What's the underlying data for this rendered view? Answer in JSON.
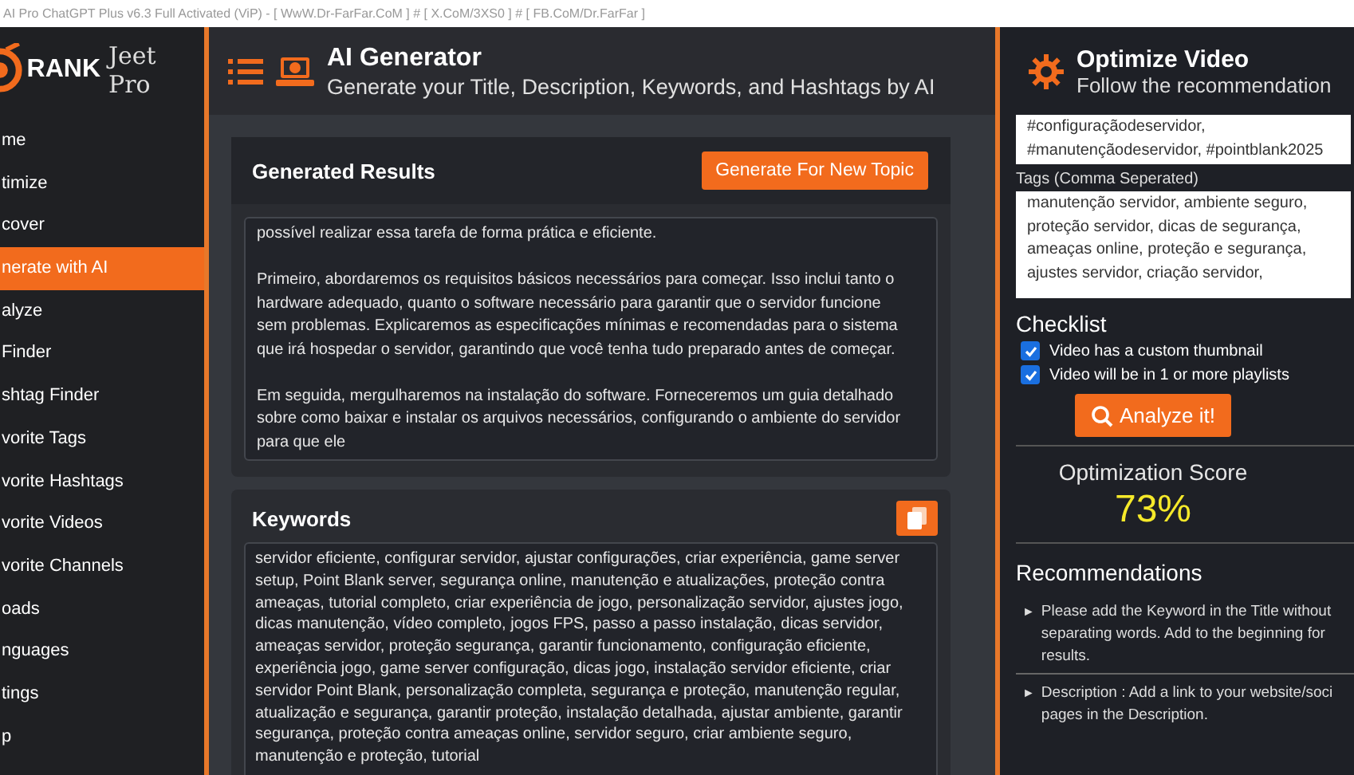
{
  "window": {
    "title": "AI Pro ChatGPT Plus v6.3 Full Activated (ViP) - [ WwW.Dr-FarFar.CoM ] # [ X.CoM/3XS0 ] # [ FB.CoM/Dr.FarFar ]"
  },
  "logo": {
    "brand": "RANK",
    "name": "Jeet Pro"
  },
  "sidebar": {
    "items": [
      {
        "label": "me",
        "selected": false
      },
      {
        "label": "timize",
        "selected": false
      },
      {
        "label": "cover",
        "selected": false
      },
      {
        "label": "nerate with AI",
        "selected": true
      },
      {
        "label": "alyze",
        "selected": false
      },
      {
        "label": "Finder",
        "selected": false
      },
      {
        "label": "shtag Finder",
        "selected": false
      },
      {
        "label": "vorite Tags",
        "selected": false
      },
      {
        "label": "vorite Hashtags",
        "selected": false
      },
      {
        "label": "vorite Videos",
        "selected": false
      },
      {
        "label": "vorite Channels",
        "selected": false
      },
      {
        "label": "oads",
        "selected": false
      },
      {
        "label": "nguages",
        "selected": false
      },
      {
        "label": "tings",
        "selected": false
      },
      {
        "label": "p",
        "selected": false
      }
    ]
  },
  "header": {
    "title": "AI Generator",
    "subtitle": "Generate your Title, Description, Keywords, and Hashtags by AI"
  },
  "results": {
    "title": "Generated Results",
    "button": "Generate For New Topic",
    "paragraphs": [
      "possível realizar essa tarefa de forma prática e eficiente.",
      "Primeiro, abordaremos os requisitos básicos necessários para começar. Isso inclui tanto o hardware adequado, quanto o software necessário para garantir que o servidor funcione sem problemas. Explicaremos as especificações mínimas e recomendadas para o sistema que irá hospedar o servidor, garantindo que você tenha tudo preparado antes de começar.",
      "Em seguida, mergulharemos na instalação do software. Forneceremos um guia detalhado sobre como baixar e instalar os arquivos necessários, configurando o ambiente do servidor para que ele"
    ]
  },
  "keywords": {
    "title": "Keywords",
    "text": "servidor eficiente, configurar servidor, ajustar configurações, criar experiência, game server setup, Point Blank server, segurança online, manutenção e atualizações, proteção contra ameaças, tutorial completo, criar experiência de jogo, personalização servidor, ajustes jogo, dicas manutenção, vídeo completo, jogos FPS, passo a passo instalação, dicas servidor, ameaças servidor, proteção segurança, garantir funcionamento, configuração eficiente, experiência jogo, game server configuração, dicas jogo, instalação servidor eficiente, criar servidor Point Blank, personalização completa, segurança e proteção, manutenção regular, atualização e segurança, garantir proteção, instalação detalhada, ajustar ambiente, garantir segurança, proteção contra ameaças online, servidor seguro, criar ambiente seguro, manutenção e proteção, tutorial"
  },
  "optimize": {
    "title": "Optimize Video",
    "subtitle": "Follow the recommendation",
    "hashtags": "#configuraçãodeservidor, #manutençãodeservidor, #pointblank2025",
    "tags_label": "Tags (Comma Seperated)",
    "tags": "manutenção servidor, ambiente seguro, proteção servidor, dicas de segurança, ameaças online, proteção e segurança, ajustes servidor, criação servidor,",
    "checklist_title": "Checklist",
    "checklist": [
      {
        "label": "Video has a custom thumbnail",
        "checked": true
      },
      {
        "label": "Video will be in 1 or more playlists",
        "checked": true
      }
    ],
    "analyze_button": "Analyze it!",
    "score_label": "Optimization Score",
    "score": "73%",
    "recommendations_title": "Recommendations",
    "recommendations": [
      {
        "marker": "►",
        "lines": [
          "Please add the Keyword in the Title without",
          "separating words. Add to the beginning for",
          "results."
        ]
      },
      {
        "marker": "►",
        "lines": [
          "Description : Add a link to your website/soci",
          "pages in the Description."
        ]
      }
    ]
  }
}
